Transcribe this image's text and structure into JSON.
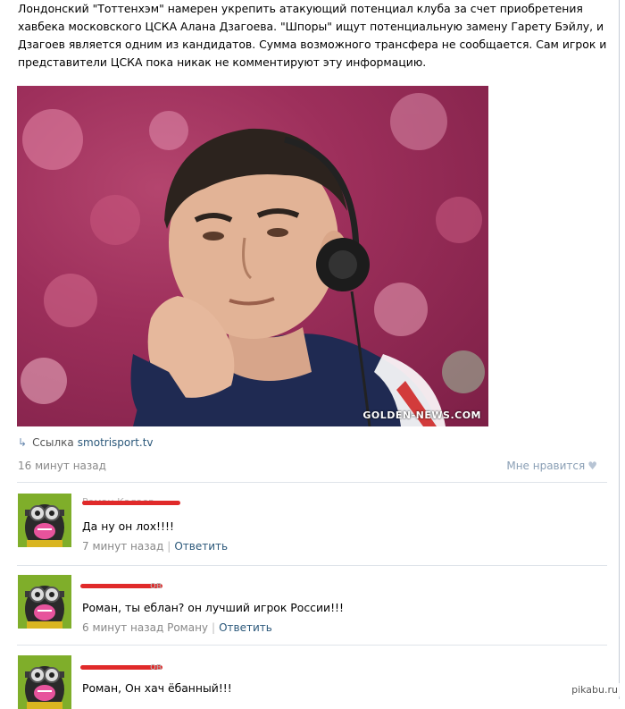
{
  "post": {
    "text": "Лондонский \"Тоттенхэм\" намерен укрепить атакующий потенциал клуба за счет приобретения хавбека московского ЦСКА Алана Дзагоева. \"Шпоры\" ищут потенциальную замену Гарету Бэйлу, и Дзагоев является одним из кандидатов. Сумма возможного трансфера не сообщается. Сам игрок и представители ЦСКА пока никак не комментируют эту информацию.",
    "photo_watermark": "GOLDEN-NEWS.COM",
    "link_label": "Ссылка",
    "link_url": "smotrisport.tv",
    "time": "16 минут назад",
    "like_label": "Мне нравится",
    "like_icon": "heart-icon"
  },
  "comments": [
    {
      "text": "Да ну он лох!!!!",
      "time": "7 минут назад",
      "reply_to": "",
      "reply_label": "Ответить"
    },
    {
      "text": "Роман, ты еблан? он лучший игрок России!!!",
      "time": "6 минут назад Роману",
      "reply_to": "",
      "reply_label": "Ответить"
    },
    {
      "text": "Роман, Он хач ёбанный!!!",
      "time": "",
      "reply_to": "",
      "reply_label": ""
    }
  ],
  "footer": {
    "site": "pikabu.ru"
  },
  "colors": {
    "link": "#2b587a",
    "meta": "#888888",
    "redact": "#e02a2a"
  }
}
